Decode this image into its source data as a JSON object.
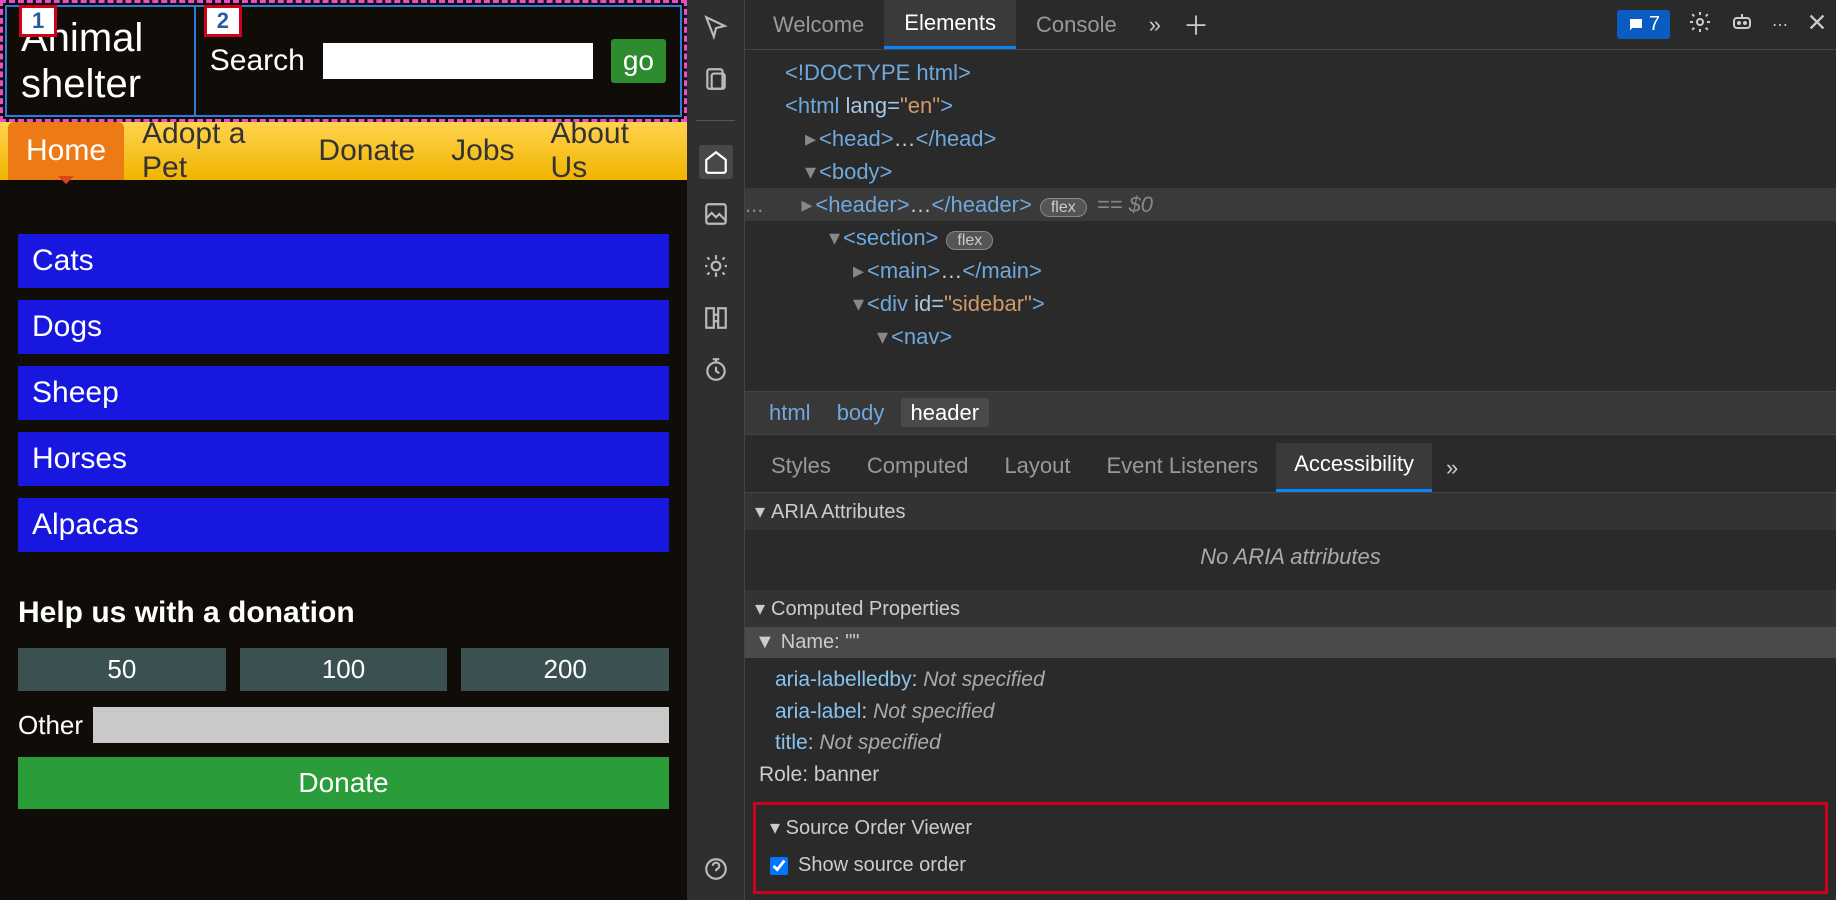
{
  "page": {
    "title": "Animal shelter",
    "badge1": "1",
    "badge2": "2",
    "search": {
      "label": "Search",
      "value": "",
      "button": "go"
    },
    "nav": [
      "Home",
      "Adopt a Pet",
      "Donate",
      "Jobs",
      "About Us"
    ],
    "categories": [
      "Cats",
      "Dogs",
      "Sheep",
      "Horses",
      "Alpacas"
    ],
    "donation": {
      "heading": "Help us with a donation",
      "amounts": [
        "50",
        "100",
        "200"
      ],
      "other_label": "Other",
      "donate_button": "Donate"
    }
  },
  "devtools": {
    "tabs": [
      "Welcome",
      "Elements",
      "Console"
    ],
    "active_tab": "Elements",
    "issues_count": "7",
    "dom": {
      "doctype": "<!DOCTYPE html>",
      "html_open": "<html lang=\"en\">",
      "head": "<head>…</head>",
      "body_open": "<body>",
      "header": "<header>…</header>",
      "header_badge": "flex",
      "header_eq": "== $0",
      "section_open": "<section>",
      "section_badge": "flex",
      "main": "<main>…</main>",
      "div_sidebar": "<div id=\"sidebar\">",
      "nav_open": "<nav>",
      "ellipsis": "..."
    },
    "breadcrumb": [
      "html",
      "body",
      "header"
    ],
    "sub_tabs": [
      "Styles",
      "Computed",
      "Layout",
      "Event Listeners",
      "Accessibility"
    ],
    "active_sub_tab": "Accessibility",
    "a11y": {
      "aria_attributes_header": "ARIA Attributes",
      "no_aria": "No ARIA attributes",
      "computed_properties_header": "Computed Properties",
      "name_label": "Name: \"\"",
      "props": [
        {
          "k": "aria-labelledby",
          "v": "Not specified"
        },
        {
          "k": "aria-label",
          "v": "Not specified"
        },
        {
          "k": "title",
          "v": "Not specified"
        }
      ],
      "role_label": "Role: ",
      "role_value": "banner",
      "sov_header": "Source Order Viewer",
      "sov_checkbox": "Show source order"
    }
  }
}
